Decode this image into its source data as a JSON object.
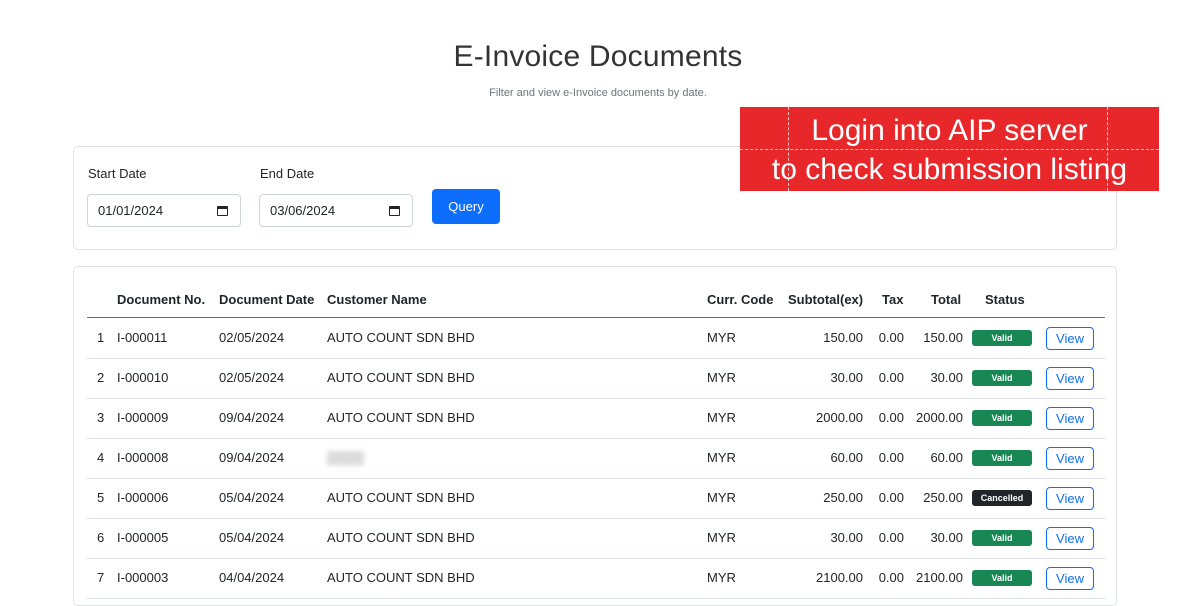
{
  "header": {
    "title": "E-Invoice Documents",
    "subtitle": "Filter and view e-Invoice documents by date."
  },
  "filters": {
    "start_label": "Start Date",
    "start_value": "01/01/2024",
    "end_label": "End Date",
    "end_value": "03/06/2024",
    "query_label": "Query"
  },
  "overlay": {
    "line1": "Login into AIP server",
    "line2": "to check submission listing",
    "color": "#e8272b"
  },
  "table": {
    "columns": [
      "",
      "Document No.",
      "Document Date",
      "Customer Name",
      "Curr. Code",
      "Subtotal(ex)",
      "Tax",
      "Total",
      "Status"
    ],
    "rows": [
      {
        "idx": "1",
        "doc_no": "I-000011",
        "date": "02/05/2024",
        "customer": "AUTO COUNT SDN BHD",
        "curr": "MYR",
        "subtotal": "150.00",
        "tax": "0.00",
        "total": "150.00",
        "status": "Valid",
        "action": "View"
      },
      {
        "idx": "2",
        "doc_no": "I-000010",
        "date": "02/05/2024",
        "customer": "AUTO COUNT SDN BHD",
        "curr": "MYR",
        "subtotal": "30.00",
        "tax": "0.00",
        "total": "30.00",
        "status": "Valid",
        "action": "View"
      },
      {
        "idx": "3",
        "doc_no": "I-000009",
        "date": "09/04/2024",
        "customer": "AUTO COUNT SDN BHD",
        "curr": "MYR",
        "subtotal": "2000.00",
        "tax": "0.00",
        "total": "2000.00",
        "status": "Valid",
        "action": "View"
      },
      {
        "idx": "4",
        "doc_no": "I-000008",
        "date": "09/04/2024",
        "customer": "",
        "curr": "MYR",
        "subtotal": "60.00",
        "tax": "0.00",
        "total": "60.00",
        "status": "Valid",
        "action": "View"
      },
      {
        "idx": "5",
        "doc_no": "I-000006",
        "date": "05/04/2024",
        "customer": "AUTO COUNT SDN BHD",
        "curr": "MYR",
        "subtotal": "250.00",
        "tax": "0.00",
        "total": "250.00",
        "status": "Cancelled",
        "action": "View"
      },
      {
        "idx": "6",
        "doc_no": "I-000005",
        "date": "05/04/2024",
        "customer": "AUTO COUNT SDN BHD",
        "curr": "MYR",
        "subtotal": "30.00",
        "tax": "0.00",
        "total": "30.00",
        "status": "Valid",
        "action": "View"
      },
      {
        "idx": "7",
        "doc_no": "I-000003",
        "date": "04/04/2024",
        "customer": "AUTO COUNT SDN BHD",
        "curr": "MYR",
        "subtotal": "2100.00",
        "tax": "0.00",
        "total": "2100.00",
        "status": "Valid",
        "action": "View"
      }
    ],
    "status_colors": {
      "Valid": "#198754",
      "Cancelled": "#212529"
    }
  }
}
